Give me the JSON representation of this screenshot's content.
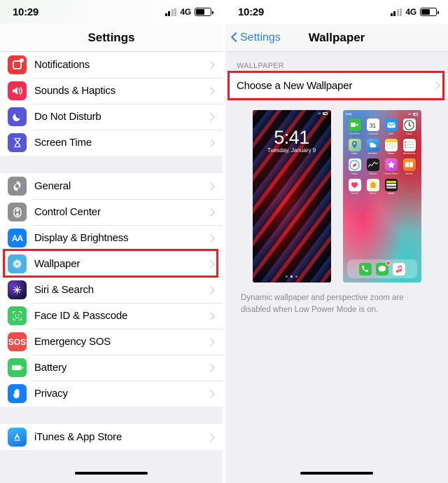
{
  "status_bar": {
    "time": "10:29",
    "network": "4G",
    "signal_icon": "signal-bars-icon",
    "battery_icon": "battery-icon"
  },
  "left_panel": {
    "nav": {
      "title": "Settings"
    },
    "groups": [
      {
        "rows": [
          {
            "label": "Notifications",
            "icon": "notifications-icon",
            "color": "#f0373c"
          },
          {
            "label": "Sounds & Haptics",
            "icon": "sounds-icon",
            "color": "#f22f52"
          },
          {
            "label": "Do Not Disturb",
            "icon": "moon-icon",
            "color": "#5756d6"
          },
          {
            "label": "Screen Time",
            "icon": "hourglass-icon",
            "color": "#5756d6"
          }
        ]
      },
      {
        "rows": [
          {
            "label": "General",
            "icon": "gear-icon",
            "color": "#8e8e93"
          },
          {
            "label": "Control Center",
            "icon": "control-center-icon",
            "color": "#8e8e93"
          },
          {
            "label": "Display & Brightness",
            "icon": "display-icon",
            "color": "#147efb"
          },
          {
            "label": "Wallpaper",
            "icon": "wallpaper-icon",
            "color": "#4cb2e5",
            "highlighted": true
          },
          {
            "label": "Siri & Search",
            "icon": "siri-icon",
            "color": "#2a1e5c"
          },
          {
            "label": "Face ID & Passcode",
            "icon": "face-id-icon",
            "color": "#37cc61"
          },
          {
            "label": "Emergency SOS",
            "icon": "sos-icon",
            "color": "#ef4b49"
          },
          {
            "label": "Battery",
            "icon": "battery-icon",
            "color": "#37cc61"
          },
          {
            "label": "Privacy",
            "icon": "hand-icon",
            "color": "#147efb"
          }
        ]
      },
      {
        "rows": [
          {
            "label": "iTunes & App Store",
            "icon": "app-store-icon",
            "color": "#1172e8"
          }
        ]
      }
    ]
  },
  "right_panel": {
    "nav": {
      "back_label": "Settings",
      "title": "Wallpaper"
    },
    "section_header": "WALLPAPER",
    "choose_row": {
      "label": "Choose a New Wallpaper",
      "highlighted": true
    },
    "lock_preview": {
      "time": "5:41",
      "date": "Tuesday, January 9",
      "network": "4G"
    },
    "home_preview": {
      "time": "9:41",
      "network": "4G",
      "apps": [
        {
          "name": "FaceTime",
          "color": "#3ac14b"
        },
        {
          "name": "Calendar",
          "color": "#ffffff",
          "day": "31"
        },
        {
          "name": "Mail",
          "color": "#2196f3"
        },
        {
          "name": "Clock",
          "color": "#ffffff"
        },
        {
          "name": "Maps",
          "color": "#b7e08a"
        },
        {
          "name": "Weather",
          "color": "#2f9ff0"
        },
        {
          "name": "Notes",
          "color": "#fbd14b"
        },
        {
          "name": "Reminders",
          "color": "#ffffff"
        },
        {
          "name": "Safari",
          "color": "#f0f4f8"
        },
        {
          "name": "Stocks",
          "color": "#1a1a1a"
        },
        {
          "name": "iTunes Store",
          "color": "#e763e0"
        },
        {
          "name": "Books",
          "color": "#f5812f"
        },
        {
          "name": "Health",
          "color": "#ffffff"
        },
        {
          "name": "Home",
          "color": "#fbf3d6"
        },
        {
          "name": "Wallet",
          "color": "#1a1a1a"
        }
      ],
      "dock": [
        {
          "name": "Phone",
          "color": "#3ac14b"
        },
        {
          "name": "Messages",
          "color": "#3ac14b",
          "badge": "2"
        },
        {
          "name": "Music",
          "color": "#ffffff"
        }
      ]
    },
    "footnote": "Dynamic wallpaper and perspective zoom are disabled when Low Power Mode is on."
  },
  "highlight_color": "#ee1c23"
}
